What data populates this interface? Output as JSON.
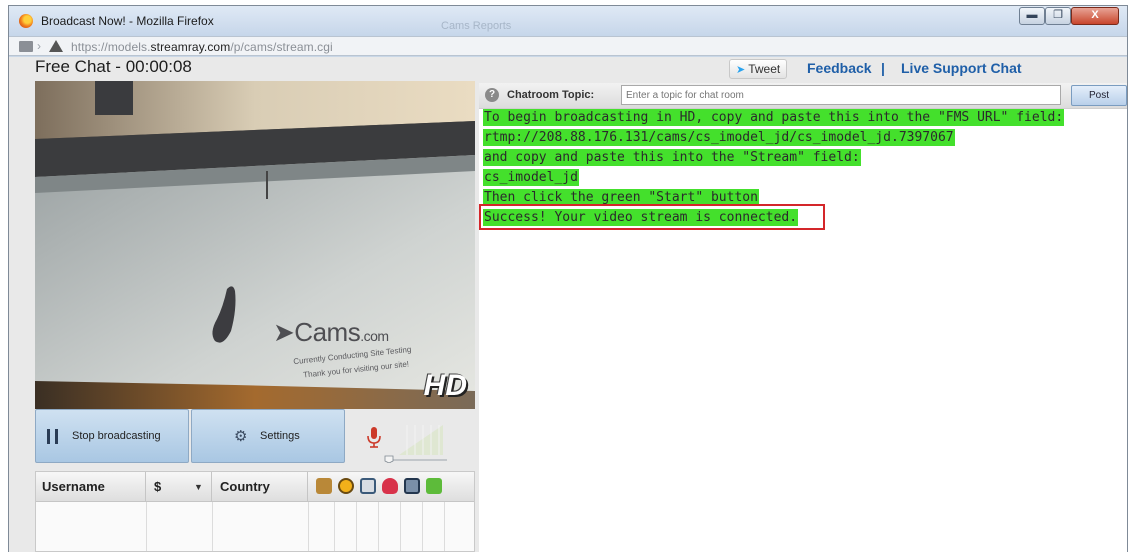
{
  "window": {
    "title": "Broadcast Now! - Mozilla Firefox",
    "background_tab_title": "Cams Reports",
    "min_glyph": "▬",
    "max_glyph": "❐",
    "close_glyph": "X"
  },
  "address_bar": {
    "url_prefix": "https://models.",
    "url_domain": "streamray.com",
    "url_path": "/p/cams/stream.cgi",
    "separator": "›"
  },
  "header": {
    "title": "Free Chat - 00:00:08",
    "tweet_label": "Tweet",
    "feedback_label": "Feedback",
    "separator": "|",
    "support_label": "Live Support Chat"
  },
  "video": {
    "hd_badge": "HD",
    "logo_text": "Cams",
    "logo_suffix": ".com",
    "tagline_1": "Currently Conducting Site Testing",
    "tagline_2": "Thank you for visiting our site!"
  },
  "controls": {
    "stop_label": "Stop broadcasting",
    "settings_label": "Settings",
    "volume_level": 0.1
  },
  "user_table": {
    "columns": [
      "Username",
      "$",
      "Country"
    ],
    "icon_columns": [
      "person-icon",
      "smiley-icon",
      "camera-icon",
      "heart-icon",
      "tablet-icon",
      "money-icon"
    ]
  },
  "chat": {
    "help_glyph": "?",
    "topic_label": "Chatroom Topic:",
    "topic_placeholder": "Enter a topic for chat room",
    "post_label": "Post",
    "lines": [
      "To begin broadcasting in HD, copy and paste this into the \"FMS URL\" field:",
      "rtmp://208.88.176.131/cams/cs_imodel_jd/cs_imodel_jd.7397067",
      "and copy and paste this into the \"Stream\" field:",
      "cs_imodel_jd",
      "Then click the green \"Start\" button",
      "Success! Your video stream is connected."
    ],
    "highlight_color": "#44e02c",
    "callout_color": "#d4262a"
  }
}
